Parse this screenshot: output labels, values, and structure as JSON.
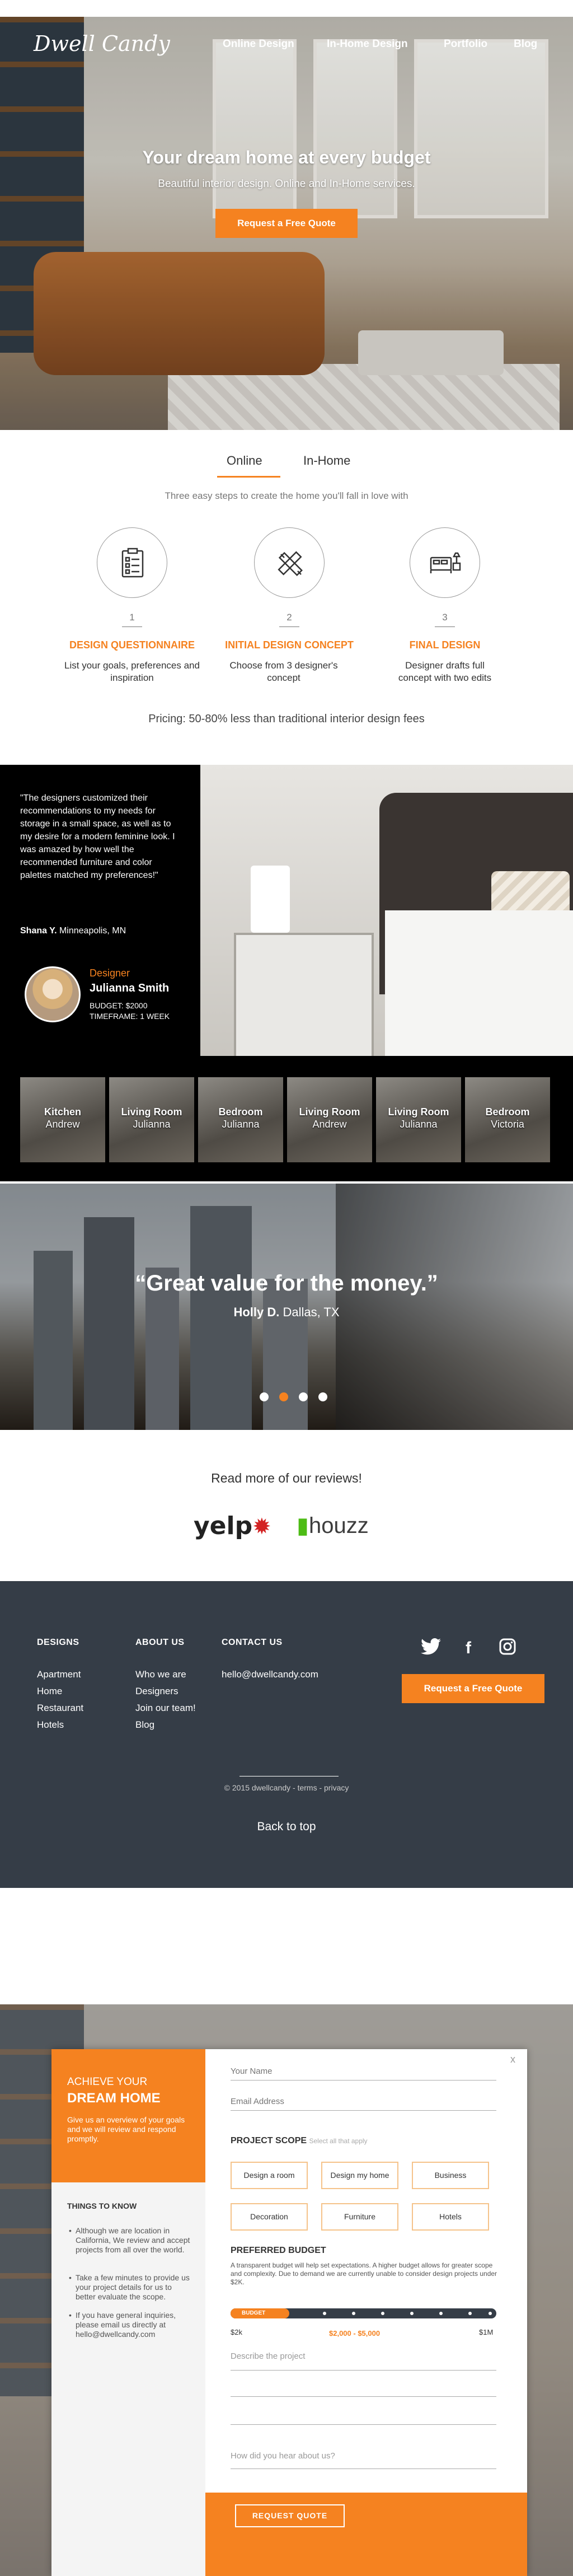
{
  "header": {
    "logo": "Dwell Candy",
    "nav": [
      "Online Design",
      "In-Home Design",
      "Portfolio",
      "Blog"
    ]
  },
  "hero": {
    "title": "Your dream home at every budget",
    "subtitle": "Beautiful interior design. Online and In-Home services.",
    "cta": "Request a Free Quote"
  },
  "steps_section": {
    "tabs": [
      "Online",
      "In-Home"
    ],
    "active_tab": "Online",
    "lead": "Three easy steps to create the home you'll fall in love with",
    "steps": [
      {
        "num": "1",
        "title": "DESIGN QUESTIONNAIRE",
        "desc": "List your goals, preferences and inspiration",
        "icon": "clipboard-icon"
      },
      {
        "num": "2",
        "title": "INITIAL DESIGN CONCEPT",
        "desc": "Choose from 3 designer's concept",
        "icon": "pencil-ruler-icon"
      },
      {
        "num": "3",
        "title": "FINAL DESIGN",
        "desc": "Designer drafts full concept with two edits",
        "icon": "bed-icon"
      }
    ],
    "pricing": "Pricing: 50-80% less than traditional interior design fees"
  },
  "testimonial": {
    "quote": "\"The designers customized their recommendations to my needs for storage in a small space, as well as to my desire for a modern feminine look. I was amazed by how well the recommended furniture and color palettes matched my preferences!\"",
    "author_name": "Shana Y.",
    "author_place": "Minneapolis, MN",
    "designer_role": "Designer",
    "designer_name": "Julianna Smith",
    "budget": "BUDGET: $2000",
    "timeframe": "TIMEFRAME: 1 WEEK",
    "thumbs": [
      {
        "room": "Kitchen",
        "name": "Andrew"
      },
      {
        "room": "Living Room",
        "name": "Julianna"
      },
      {
        "room": "Bedroom",
        "name": "Julianna"
      },
      {
        "room": "Living Room",
        "name": "Andrew"
      },
      {
        "room": "Living Room",
        "name": "Julianna"
      },
      {
        "room": "Bedroom",
        "name": "Victoria"
      }
    ]
  },
  "city_quote": {
    "quote": "“Great value for the money.”",
    "author_name": "Holly D.",
    "author_place": "Dallas, TX",
    "dots": 4,
    "active_dot": 2
  },
  "reviews": {
    "title": "Read more of our reviews!",
    "yelp": "yelp",
    "houzz": "houzz"
  },
  "footer": {
    "designs_heading": "DESIGNS",
    "designs": [
      "Apartment",
      "Home",
      "Restaurant",
      "Hotels"
    ],
    "about_heading": "ABOUT US",
    "about": [
      "Who we are",
      "Designers",
      "Join our team!",
      "Blog"
    ],
    "contact_heading": "CONTACT US",
    "email": "hello@dwellcandy.com",
    "cta": "Request a Free Quote",
    "copyright": "© 2015 dwellcandy - terms - privacy",
    "back_to_top": "Back to top"
  },
  "modal": {
    "kicker": "ACHIEVE YOUR",
    "title": "DREAM HOME",
    "intro": "Give us an overview of your goals and we will review and respond promptly.",
    "things_heading": "THINGS TO KNOW",
    "things": [
      "Although we are location in California, We review and accept projects from all over the world.",
      "Take a few minutes to provide us your project details for us to better evaluate the scope.",
      "If you have general inquiries, please email us directly at hello@dwellcandy.com"
    ],
    "close": "x",
    "name_placeholder": "Your Name",
    "email_placeholder": "Email Address",
    "scope_label": "PROJECT SCOPE",
    "scope_hint": "Select all that apply",
    "scope_options": [
      "Design a room",
      "Design my home",
      "Business",
      "Decoration",
      "Furniture",
      "Hotels"
    ],
    "budget_label": "PREFERRED BUDGET",
    "budget_text": "A transparent budget will help set expectations. A higher budget allows for greater scope and complexity. Due to demand we are currently unable to consider design projects under $2K.",
    "slider_label": "BUDGET",
    "slider_min": "$2k",
    "slider_max": "$1M",
    "slider_value": "$2,000 - $5,000",
    "slider_level": 0.22,
    "describe_placeholder": "Describe the project",
    "hear_placeholder": "How did you hear about us?",
    "submit": "REQUEST QUOTE"
  },
  "colors": {
    "accent": "#f58220",
    "footer_bg": "#353d47"
  }
}
